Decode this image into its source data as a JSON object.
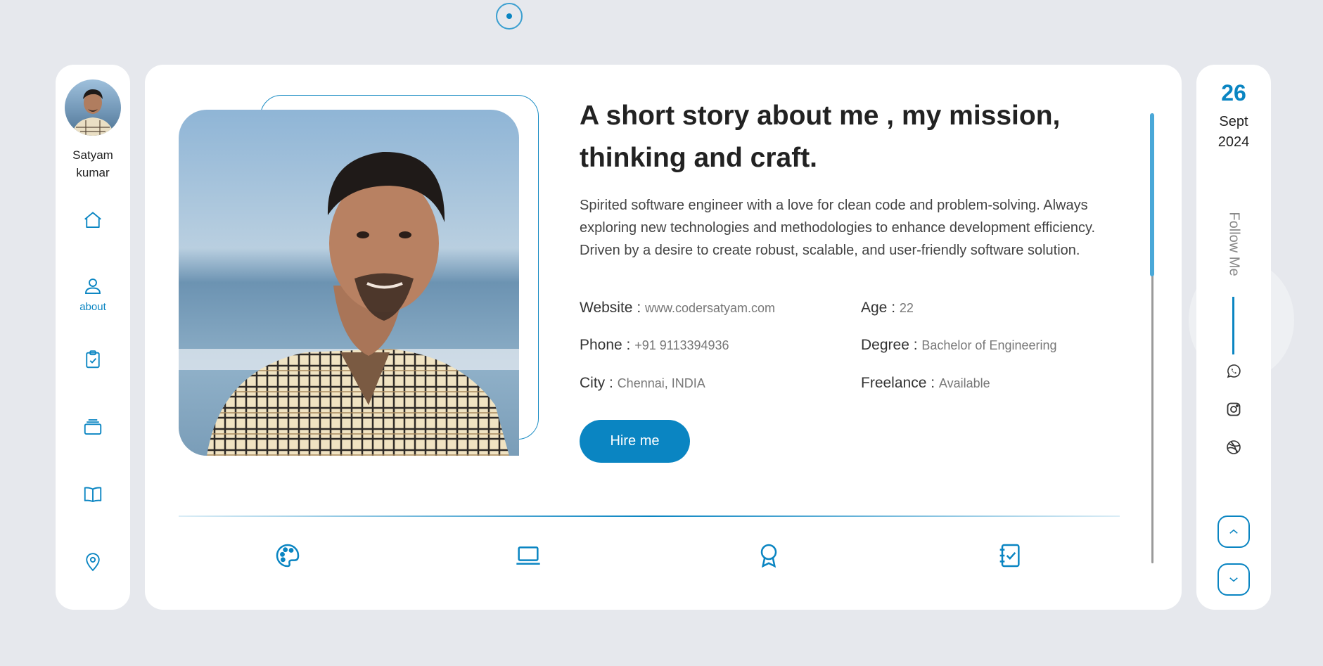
{
  "profile": {
    "name": "Satyam kumar"
  },
  "nav": {
    "items": [
      {
        "icon": "home-icon"
      },
      {
        "icon": "user-icon",
        "label": "about",
        "active": true
      },
      {
        "icon": "clipboard-check-icon"
      },
      {
        "icon": "layers-icon"
      },
      {
        "icon": "book-icon"
      },
      {
        "icon": "map-pin-icon"
      }
    ]
  },
  "about": {
    "headline": "A short story about me , my mission, thinking and craft.",
    "bio": "Spirited software engineer with a love for clean code and problem-solving. Always exploring new technologies and methodologies to enhance development efficiency. Driven by a desire to create robust, scalable, and user-friendly software solution.",
    "info": [
      {
        "label": "Website :",
        "value": "www.codersatyam.com"
      },
      {
        "label": "Age :",
        "value": "22"
      },
      {
        "label": "Phone :",
        "value": "+91 9113394936"
      },
      {
        "label": "Degree :",
        "value": "Bachelor of Engineering"
      },
      {
        "label": "City :",
        "value": "Chennai, INDIA"
      },
      {
        "label": "Freelance :",
        "value": "Available"
      }
    ],
    "hire_label": "Hire me",
    "service_icons": [
      "palette-icon",
      "laptop-icon",
      "award-icon",
      "notebook-check-icon"
    ]
  },
  "date": {
    "day": "26",
    "month": "Sept",
    "year": "2024"
  },
  "follow": {
    "label": "Follow Me",
    "socials": [
      "whatsapp-icon",
      "instagram-icon",
      "dribbble-icon"
    ]
  },
  "colors": {
    "accent": "#0a85c2",
    "background": "#e6e8ed",
    "card": "#ffffff"
  }
}
